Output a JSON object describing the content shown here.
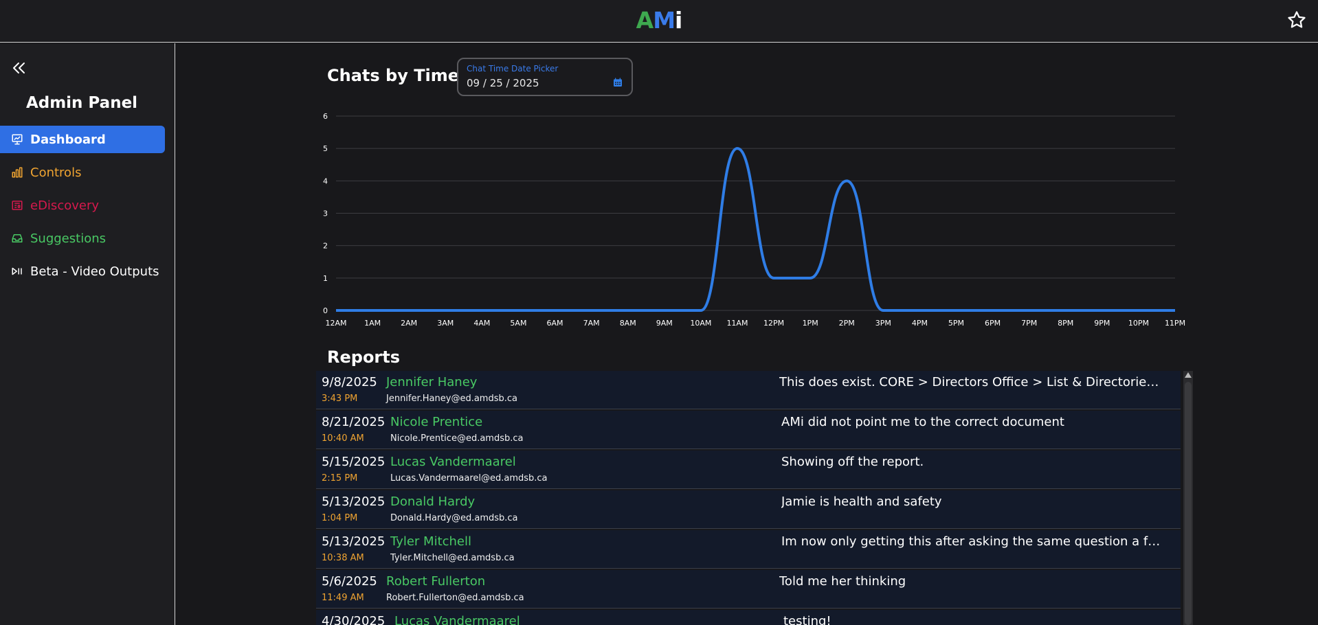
{
  "app": {
    "logo_a": "A",
    "logo_m": "M",
    "logo_i": "i",
    "star_icon": "star-outline-icon"
  },
  "sidebar": {
    "title": "Admin Panel",
    "items": [
      {
        "label": "Dashboard",
        "icon": "presentation-chart-icon",
        "active": true
      },
      {
        "label": "Controls",
        "icon": "bar-chart-icon",
        "color": "#f0a431"
      },
      {
        "label": "eDiscovery",
        "icon": "newspaper-icon",
        "color": "#d6194d"
      },
      {
        "label": "Suggestions",
        "icon": "inbox-icon",
        "color": "#49c964"
      },
      {
        "label": "Beta - Video Outputs",
        "icon": "play-pause-icon",
        "color": "#ffffff"
      }
    ]
  },
  "chats_section": {
    "title": "Chats by Time",
    "datepicker": {
      "label": "Chat Time Date Picker",
      "month": "09",
      "day": "25",
      "year": "2025"
    }
  },
  "chart_data": {
    "type": "line",
    "x": [
      "12AM",
      "1AM",
      "2AM",
      "3AM",
      "4AM",
      "5AM",
      "6AM",
      "7AM",
      "8AM",
      "9AM",
      "10AM",
      "11AM",
      "12PM",
      "1PM",
      "2PM",
      "3PM",
      "4PM",
      "5PM",
      "6PM",
      "7PM",
      "8PM",
      "9PM",
      "10PM",
      "11PM"
    ],
    "series": [
      {
        "values": [
          0,
          0,
          0,
          0,
          0,
          0,
          0,
          0,
          0,
          0,
          0,
          5,
          1,
          1,
          4,
          0,
          0,
          0,
          0,
          0,
          0,
          0,
          0,
          0
        ],
        "color": "#2f7de6"
      }
    ],
    "yticks": [
      0,
      1,
      2,
      3,
      4,
      5,
      6
    ],
    "ylim": [
      0,
      6
    ],
    "grid": true,
    "curve": "smooth"
  },
  "reports": {
    "title": "Reports",
    "rows": [
      {
        "date": "9/8/2025",
        "time": "3:43 PM",
        "name": "Jennifer Haney",
        "email": "Jennifer.Haney@ed.amdsb.ca",
        "message": "This does exist. CORE > Directors Office > List & Directories /AMDSB Staff Directory"
      },
      {
        "date": "8/21/2025",
        "time": "10:40 AM",
        "name": "Nicole Prentice",
        "email": "Nicole.Prentice@ed.amdsb.ca",
        "message": "AMi did not point me to the correct document"
      },
      {
        "date": "5/15/2025",
        "time": "2:15 PM",
        "name": "Lucas Vandermaarel",
        "email": "Lucas.Vandermaarel@ed.amdsb.ca",
        "message": "Showing off the report."
      },
      {
        "date": "5/13/2025",
        "time": "1:04 PM",
        "name": "Donald Hardy",
        "email": "Donald.Hardy@ed.amdsb.ca",
        "message": "Jamie is health and safety"
      },
      {
        "date": "5/13/2025",
        "time": "10:38 AM",
        "name": "Tyler Mitchell",
        "email": "Tyler.Mitchell@ed.amdsb.ca",
        "message": "Im now only getting this after asking the same question a few times in a row"
      },
      {
        "date": "5/6/2025",
        "time": "11:49 AM",
        "name": "Robert Fullerton",
        "email": "Robert.Fullerton@ed.amdsb.ca",
        "message": "Told me her thinking"
      },
      {
        "date": "4/30/2025",
        "time": "",
        "name": "Lucas Vandermaarel",
        "email": "",
        "message": "testing!"
      }
    ]
  }
}
